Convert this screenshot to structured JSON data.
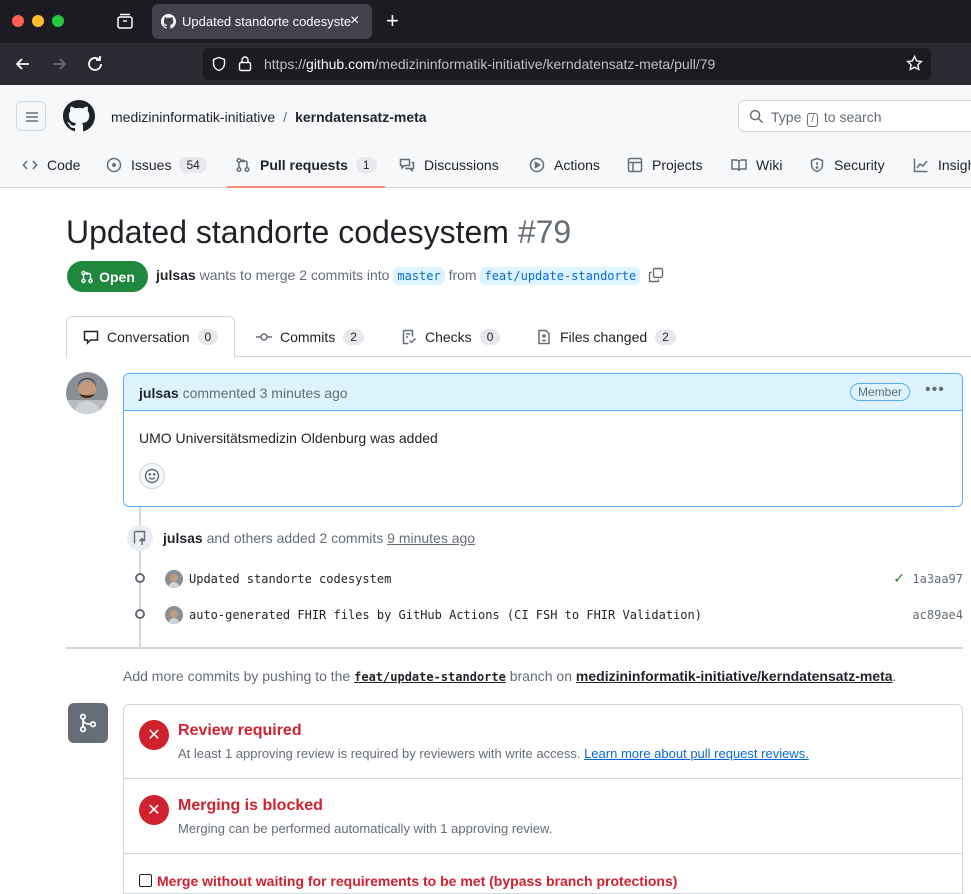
{
  "browser": {
    "tab_title": "Updated standorte codesystem",
    "url_prefix": "https://",
    "url_host": "github.com",
    "url_path": "/medizininformatik-initiative/kerndatensatz-meta/pull/79"
  },
  "header": {
    "owner": "medizininformatik-initiative",
    "separator": "/",
    "repo": "kerndatensatz-meta",
    "search_prefix": "Type",
    "search_key": "/",
    "search_suffix": "to search"
  },
  "repo_nav": {
    "code": "Code",
    "issues": "Issues",
    "issues_count": "54",
    "pulls": "Pull requests",
    "pulls_count": "1",
    "discussions": "Discussions",
    "actions": "Actions",
    "projects": "Projects",
    "wiki": "Wiki",
    "security": "Security",
    "insights": "Insights"
  },
  "pr": {
    "title": "Updated standorte codesystem",
    "number": "#79",
    "state": "Open",
    "author": "julsas",
    "meta_text": "wants to merge 2 commits into",
    "base": "master",
    "from": "from",
    "head": "feat/update-standorte"
  },
  "pr_tabs": {
    "conversation": "Conversation",
    "conversation_count": "0",
    "commits": "Commits",
    "commits_count": "2",
    "checks": "Checks",
    "checks_count": "0",
    "files": "Files changed",
    "files_count": "2"
  },
  "comment": {
    "author": "julsas",
    "action": "commented 3 minutes ago",
    "badge": "Member",
    "body": "UMO Universitätsmedizin Oldenburg was added"
  },
  "push_event": {
    "author": "julsas",
    "text": "and others added 2 commits",
    "time": "9 minutes ago"
  },
  "commits": [
    {
      "message": "Updated standorte codesystem",
      "sha": "1a3aa97",
      "status": "✓"
    },
    {
      "message": "auto-generated FHIR files by GitHub Actions (CI FSH to FHIR Validation)",
      "sha": "ac89ae4"
    }
  ],
  "add_more": {
    "prefix": "Add more commits by pushing to the",
    "branch": "feat/update-standorte",
    "middle": "branch on",
    "repo": "medizininformatik-initiative/kerndatensatz-meta",
    "suffix": "."
  },
  "merge": {
    "review_title": "Review required",
    "review_desc": "At least 1 approving review is required by reviewers with write access.",
    "review_link": "Learn more about pull request reviews.",
    "blocked_title": "Merging is blocked",
    "blocked_desc": "Merging can be performed automatically with 1 approving review.",
    "bypass_label": "Merge without waiting for requirements to be met (bypass branch protections)"
  }
}
